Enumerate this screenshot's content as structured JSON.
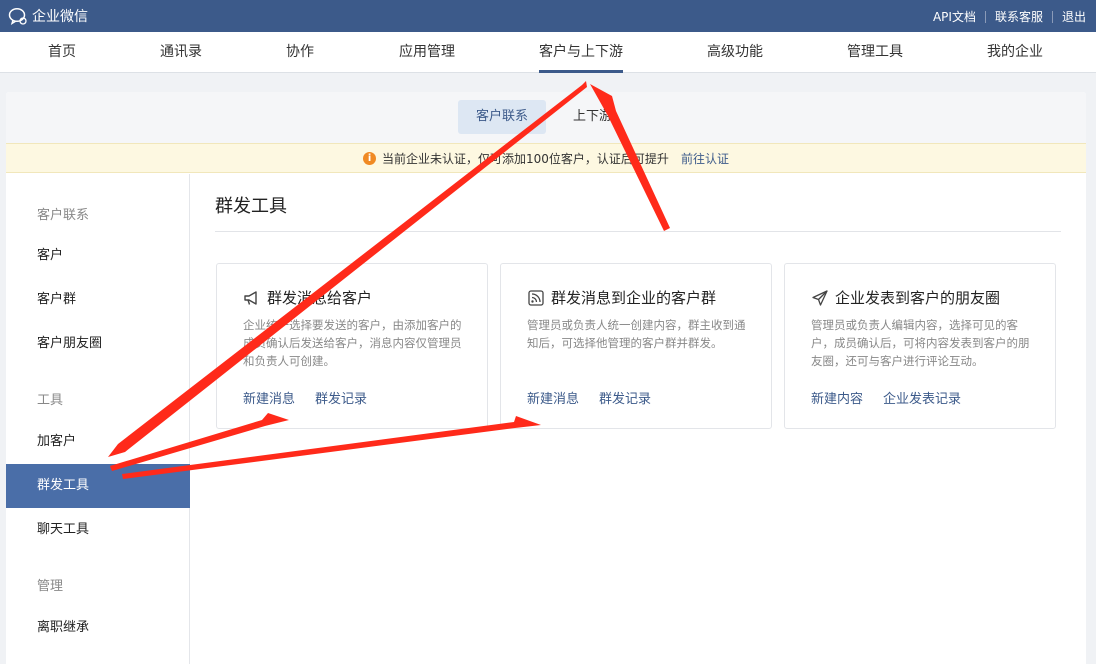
{
  "app": {
    "title": "企业微信"
  },
  "top_links": [
    "API文档",
    "联系客服",
    "退出"
  ],
  "main_nav": {
    "items": [
      "首页",
      "通讯录",
      "协作",
      "应用管理",
      "客户与上下游",
      "高级功能",
      "管理工具",
      "我的企业"
    ],
    "active": "客户与上下游"
  },
  "sub_tabs": {
    "items": [
      "客户联系",
      "上下游"
    ],
    "active": "客户联系"
  },
  "notice": {
    "icon": "warning-icon",
    "text": "当前企业未认证，仅可添加100位客户，认证后可提升",
    "link": "前往认证"
  },
  "sidebar": {
    "groups": [
      {
        "title": "客户联系",
        "items": [
          "客户",
          "客户群",
          "客户朋友圈"
        ]
      },
      {
        "title": "工具",
        "items": [
          "加客户",
          "群发工具",
          "聊天工具"
        ]
      },
      {
        "title": "管理",
        "items": [
          "离职继承"
        ]
      }
    ],
    "active": "群发工具"
  },
  "content": {
    "title": "群发工具",
    "cards": [
      {
        "icon": "megaphone-icon",
        "title": "群发消息给客户",
        "desc": "企业统一选择要发送的客户，由添加客户的成员确认后发送给客户，消息内容仅管理员和负责人可创建。",
        "links": [
          "新建消息",
          "群发记录"
        ]
      },
      {
        "icon": "broadcast-icon",
        "title": "群发消息到企业的客户群",
        "desc": "管理员或负责人统一创建内容，群主收到通知后，可选择他管理的客户群并群发。",
        "links": [
          "新建消息",
          "群发记录"
        ]
      },
      {
        "icon": "paper-plane-icon",
        "title": "企业发表到客户的朋友圈",
        "desc": "管理员或负责人编辑内容，选择可见的客户，成员确认后，可将内容发表到客户的朋友圈，还可与客户进行评论互动。",
        "links": [
          "新建内容",
          "企业发表记录"
        ]
      }
    ]
  },
  "colors": {
    "brand": "#3c5a8a",
    "sidebar_active": "#4a6ea8",
    "notice_bg": "#fdf8e1",
    "annotation": "#ff2a1a"
  }
}
